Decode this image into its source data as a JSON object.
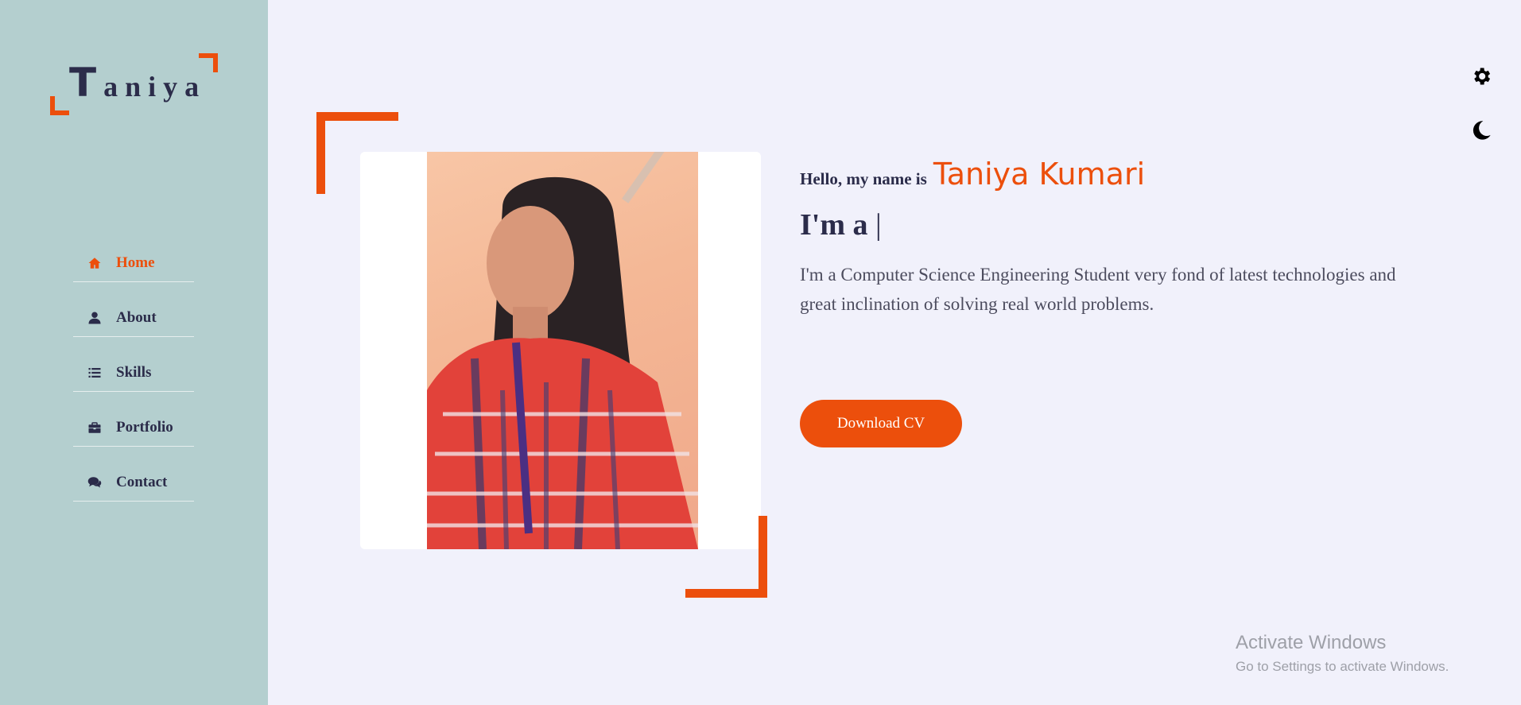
{
  "colors": {
    "accent": "#ec4f0c",
    "sidebar_bg": "#b4cfcf",
    "page_bg": "#f1f1fb",
    "text_dark": "#2b2c4a"
  },
  "logo": {
    "first_letter": "T",
    "rest": "aniya"
  },
  "nav": {
    "items": [
      {
        "label": "Home",
        "icon": "home-icon",
        "active": true
      },
      {
        "label": "About",
        "icon": "user-icon",
        "active": false
      },
      {
        "label": "Skills",
        "icon": "list-icon",
        "active": false
      },
      {
        "label": "Portfolio",
        "icon": "briefcase-icon",
        "active": false
      },
      {
        "label": "Contact",
        "icon": "comments-icon",
        "active": false
      }
    ]
  },
  "toolbar": {
    "settings_icon": "gear-icon",
    "theme_icon": "moon-icon"
  },
  "hero": {
    "greeting": "Hello, my name is",
    "name": "Taniya Kumari",
    "role_prefix": "I'm a",
    "role_cursor": "|",
    "bio": "I'm a Computer Science Engineering Student very fond of latest technologies and great inclination of solving real world problems.",
    "cta_label": "Download CV",
    "photo_alt": "Taniya Kumari"
  },
  "watermark": {
    "title": "Activate Windows",
    "subtitle": "Go to Settings to activate Windows."
  }
}
